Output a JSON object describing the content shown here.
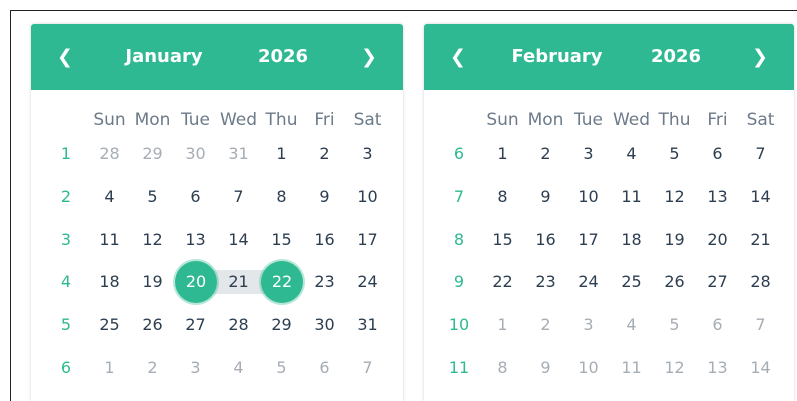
{
  "colors": {
    "accent": "#2fb992",
    "range": "#e3e7ea",
    "text": "#2c3e50",
    "muted": "#a6adb4"
  },
  "icons": {
    "prev": "chevron-left-icon",
    "next": "chevron-right-icon"
  },
  "weekdays": [
    "Sun",
    "Mon",
    "Tue",
    "Wed",
    "Thu",
    "Fri",
    "Sat"
  ],
  "calendars": [
    {
      "month": "January",
      "year": "2026",
      "prev_label": "❮",
      "next_label": "❯",
      "weeks": [
        {
          "num": "1",
          "days": [
            [
              "28",
              1
            ],
            [
              "29",
              1
            ],
            [
              "30",
              1
            ],
            [
              "31",
              1
            ],
            [
              "1",
              0
            ],
            [
              "2",
              0
            ],
            [
              "3",
              0
            ]
          ]
        },
        {
          "num": "2",
          "days": [
            [
              "4",
              0
            ],
            [
              "5",
              0
            ],
            [
              "6",
              0
            ],
            [
              "7",
              0
            ],
            [
              "8",
              0
            ],
            [
              "9",
              0
            ],
            [
              "10",
              0
            ]
          ]
        },
        {
          "num": "3",
          "days": [
            [
              "11",
              0
            ],
            [
              "12",
              0
            ],
            [
              "13",
              0
            ],
            [
              "14",
              0
            ],
            [
              "15",
              0
            ],
            [
              "16",
              0
            ],
            [
              "17",
              0
            ]
          ]
        },
        {
          "num": "4",
          "days": [
            [
              "18",
              0
            ],
            [
              "19",
              0
            ],
            [
              "20",
              0
            ],
            [
              "21",
              0
            ],
            [
              "22",
              0
            ],
            [
              "23",
              0
            ],
            [
              "24",
              0
            ]
          ]
        },
        {
          "num": "5",
          "days": [
            [
              "25",
              0
            ],
            [
              "26",
              0
            ],
            [
              "27",
              0
            ],
            [
              "28",
              0
            ],
            [
              "29",
              0
            ],
            [
              "30",
              0
            ],
            [
              "31",
              0
            ]
          ]
        },
        {
          "num": "6",
          "days": [
            [
              "1",
              1
            ],
            [
              "2",
              1
            ],
            [
              "3",
              1
            ],
            [
              "4",
              1
            ],
            [
              "5",
              1
            ],
            [
              "6",
              1
            ],
            [
              "7",
              1
            ]
          ]
        }
      ],
      "range_start": "20",
      "range_mid": "21",
      "range_end": "22"
    },
    {
      "month": "February",
      "year": "2026",
      "prev_label": "❮",
      "next_label": "❯",
      "weeks": [
        {
          "num": "6",
          "days": [
            [
              "1",
              0
            ],
            [
              "2",
              0
            ],
            [
              "3",
              0
            ],
            [
              "4",
              0
            ],
            [
              "5",
              0
            ],
            [
              "6",
              0
            ],
            [
              "7",
              0
            ]
          ]
        },
        {
          "num": "7",
          "days": [
            [
              "8",
              0
            ],
            [
              "9",
              0
            ],
            [
              "10",
              0
            ],
            [
              "11",
              0
            ],
            [
              "12",
              0
            ],
            [
              "13",
              0
            ],
            [
              "14",
              0
            ]
          ]
        },
        {
          "num": "8",
          "days": [
            [
              "15",
              0
            ],
            [
              "16",
              0
            ],
            [
              "17",
              0
            ],
            [
              "18",
              0
            ],
            [
              "19",
              0
            ],
            [
              "20",
              0
            ],
            [
              "21",
              0
            ]
          ]
        },
        {
          "num": "9",
          "days": [
            [
              "22",
              0
            ],
            [
              "23",
              0
            ],
            [
              "24",
              0
            ],
            [
              "25",
              0
            ],
            [
              "26",
              0
            ],
            [
              "27",
              0
            ],
            [
              "28",
              0
            ]
          ]
        },
        {
          "num": "10",
          "days": [
            [
              "1",
              1
            ],
            [
              "2",
              1
            ],
            [
              "3",
              1
            ],
            [
              "4",
              1
            ],
            [
              "5",
              1
            ],
            [
              "6",
              1
            ],
            [
              "7",
              1
            ]
          ]
        },
        {
          "num": "11",
          "days": [
            [
              "8",
              1
            ],
            [
              "9",
              1
            ],
            [
              "10",
              1
            ],
            [
              "11",
              1
            ],
            [
              "12",
              1
            ],
            [
              "13",
              1
            ],
            [
              "14",
              1
            ]
          ]
        }
      ]
    }
  ]
}
